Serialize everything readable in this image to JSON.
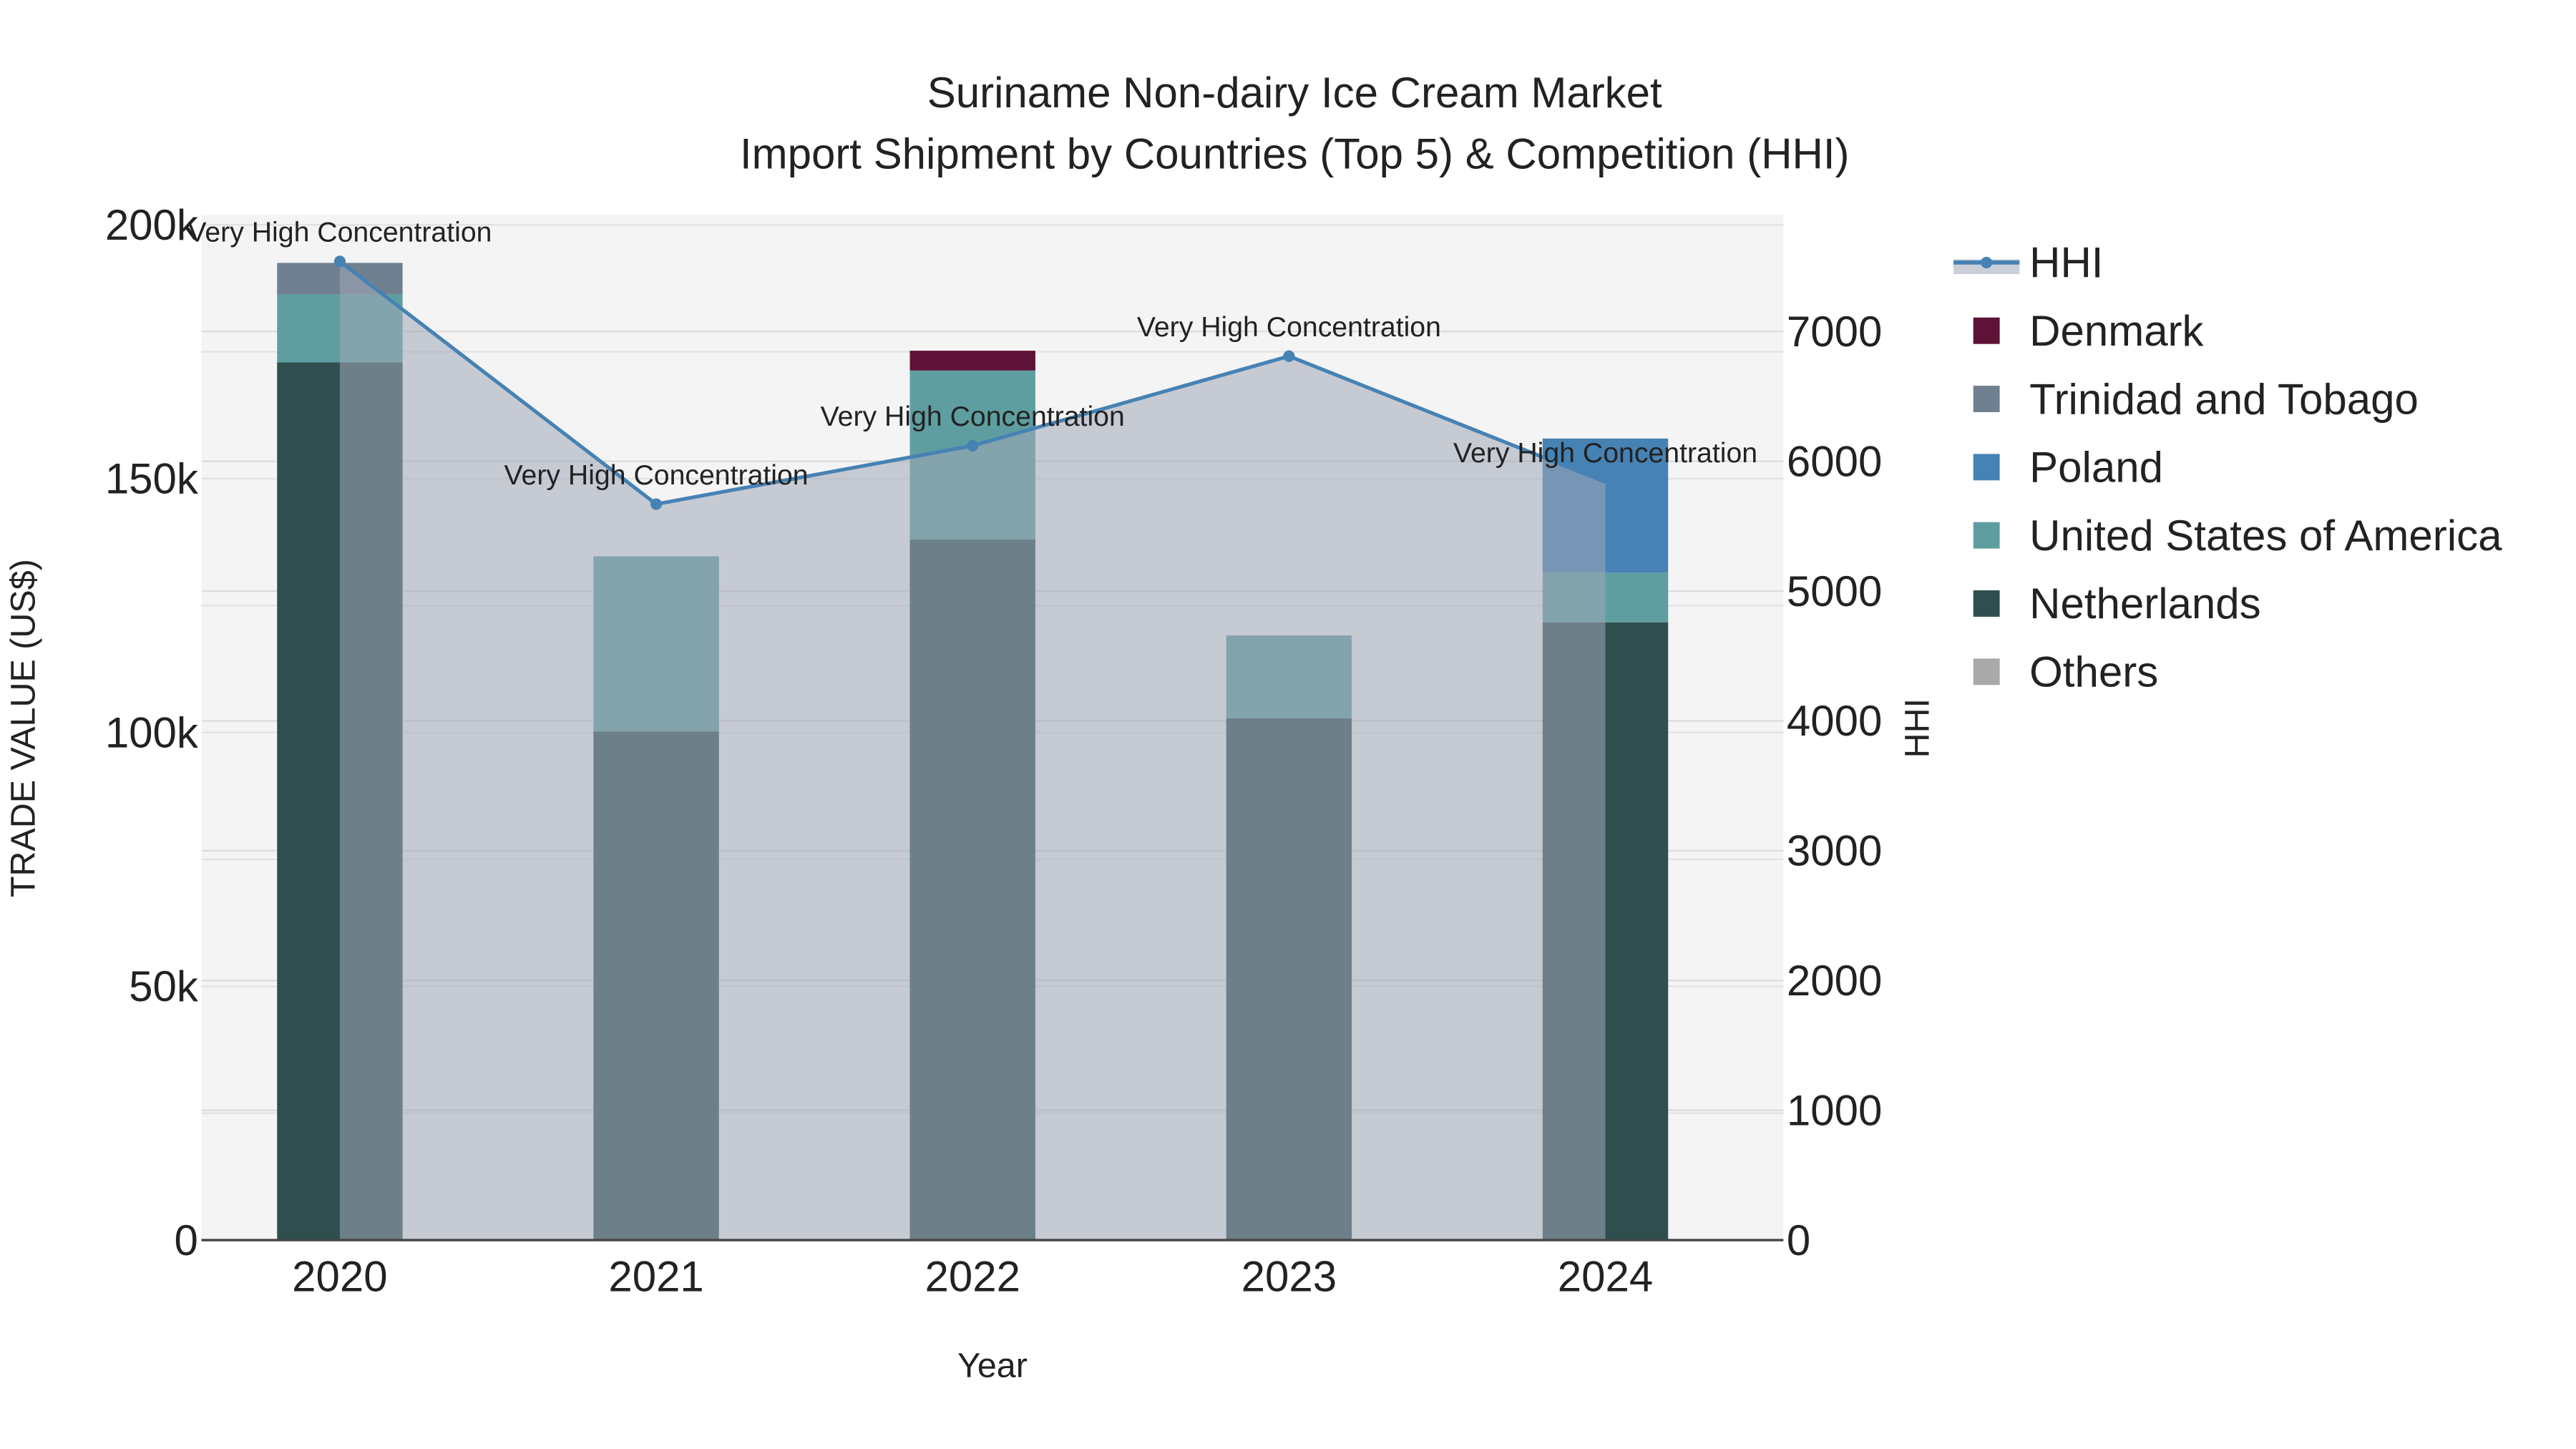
{
  "chart_data": {
    "type": "bar",
    "title": "Suriname Non-dairy Ice Cream Market",
    "subtitle": "Import Shipment by Countries (Top 5) & Competition (HHI)",
    "xlabel": "Year",
    "ylabel": "TRADE VALUE (US$)",
    "y2label": "HHI",
    "categories": [
      "2020",
      "2021",
      "2022",
      "2023",
      "2024"
    ],
    "ylim": [
      0,
      202000
    ],
    "y2lim": [
      0,
      7900
    ],
    "yticks": [
      0,
      50000,
      100000,
      150000,
      200000
    ],
    "ytick_labels": [
      "0",
      "50k",
      "100k",
      "150k",
      "200k"
    ],
    "y2ticks": [
      0,
      1000,
      2000,
      3000,
      4000,
      5000,
      6000,
      7000
    ],
    "y2tick_labels": [
      "0",
      "1000",
      "2000",
      "3000",
      "4000",
      "5000",
      "6000",
      "7000"
    ],
    "grid": true,
    "legend_position": "right",
    "series": [
      {
        "name": "Netherlands",
        "color": "#2F4F4F",
        "values": [
          172900,
          100200,
          138000,
          102800,
          121700
        ]
      },
      {
        "name": "United States of America",
        "color": "#5F9EA0",
        "values": [
          13400,
          34500,
          33300,
          16300,
          9800
        ]
      },
      {
        "name": "Poland",
        "color": "#4682B4",
        "values": [
          0,
          0,
          0,
          0,
          26400
        ]
      },
      {
        "name": "Trinidad and Tobago",
        "color": "#708090",
        "values": [
          6200,
          0,
          0,
          0,
          0
        ]
      },
      {
        "name": "Denmark",
        "color": "#5E1235",
        "values": [
          0,
          0,
          3900,
          0,
          0
        ]
      },
      {
        "name": "Others",
        "color": "#A9A9A9",
        "values": [
          0,
          0,
          0,
          0,
          0
        ]
      }
    ],
    "hhi": {
      "name": "HHI",
      "color": "#4682B4",
      "values": [
        7540,
        5670,
        6120,
        6810,
        5840
      ],
      "annotations": [
        "Very High Concentration",
        "Very High Concentration",
        "Very High Concentration",
        "Very High Concentration",
        "Very High Concentration"
      ]
    },
    "legend": [
      "HHI",
      "Denmark",
      "Trinidad and Tobago",
      "Poland",
      "United States of America",
      "Netherlands",
      "Others"
    ]
  }
}
